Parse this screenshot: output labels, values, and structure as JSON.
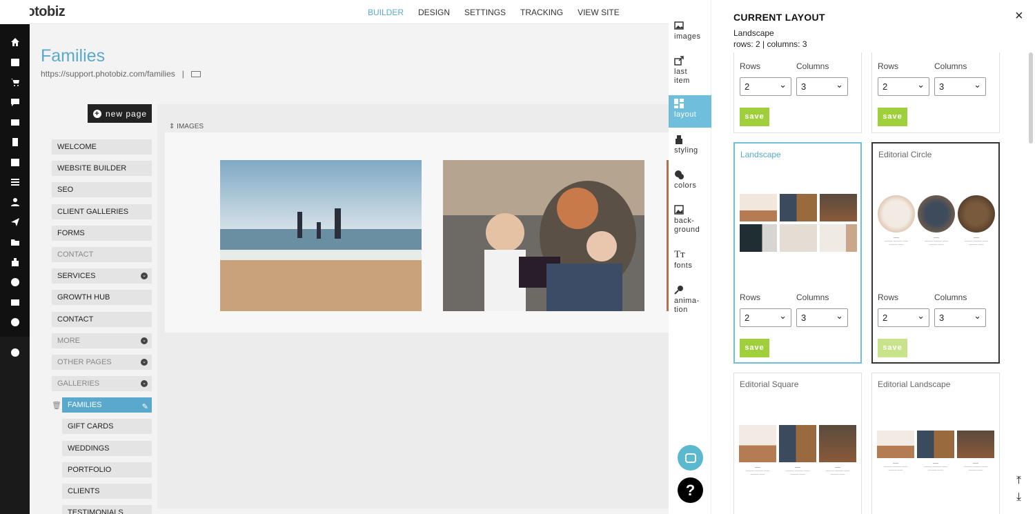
{
  "app": {
    "logo": "photobiz"
  },
  "topnav": [
    {
      "label": "BUILDER",
      "active": true
    },
    {
      "label": "DESIGN",
      "active": false
    },
    {
      "label": "SETTINGS",
      "active": false
    },
    {
      "label": "TRACKING",
      "active": false
    },
    {
      "label": "VIEW SITE",
      "active": false
    }
  ],
  "page": {
    "title": "Families",
    "url": "https://support.photobiz.com/families",
    "url_sep": "|",
    "new_page_label": "new page",
    "images_label": "IMAGES"
  },
  "nav": [
    {
      "label": "WELCOME"
    },
    {
      "label": "WEBSITE BUILDER"
    },
    {
      "label": "SEO"
    },
    {
      "label": "CLIENT GALLERIES"
    },
    {
      "label": "FORMS"
    },
    {
      "label": "CONTACT"
    },
    {
      "label": "SERVICES"
    },
    {
      "label": "GROWTH HUB"
    },
    {
      "label": "CONTACT"
    },
    {
      "label": "MORE"
    },
    {
      "label": "OTHER PAGES"
    },
    {
      "label": "GALLERIES"
    },
    {
      "label": "FAMILIES"
    },
    {
      "label": "GIFT CARDS"
    },
    {
      "label": "WEDDINGS"
    },
    {
      "label": "PORTFOLIO"
    },
    {
      "label": "CLIENTS"
    },
    {
      "label": "TESTIMONIALS"
    }
  ],
  "tools": [
    {
      "label": "images",
      "icon": "image-icon"
    },
    {
      "label": "last item",
      "icon": "share-icon"
    },
    {
      "label": "layout",
      "icon": "layout-icon"
    },
    {
      "label": "styling",
      "icon": "brush-icon"
    },
    {
      "label": "colors",
      "icon": "palette-icon"
    },
    {
      "label": "back- ground",
      "icon": "background-icon"
    },
    {
      "label": "fonts",
      "icon": "fonts-icon"
    },
    {
      "label": "anima- tion",
      "icon": "animation-icon"
    }
  ],
  "layout_panel": {
    "title": "CURRENT LAYOUT",
    "current": "Landscape",
    "dims": "rows: 2 | columns: 3",
    "close": "×",
    "rows_label": "Rows",
    "columns_label": "Columns",
    "save_label": "save",
    "rows_value": "2",
    "columns_value": "3",
    "cards": {
      "landscape": "Landscape",
      "editorial_circle": "Editorial Circle",
      "editorial_square": "Editorial Square",
      "editorial_landscape": "Editorial Landscape"
    }
  },
  "help": "?",
  "colors": {
    "accent": "#5aa9cd",
    "save": "#9fcf3b",
    "active_tool": "#6fbedc"
  }
}
